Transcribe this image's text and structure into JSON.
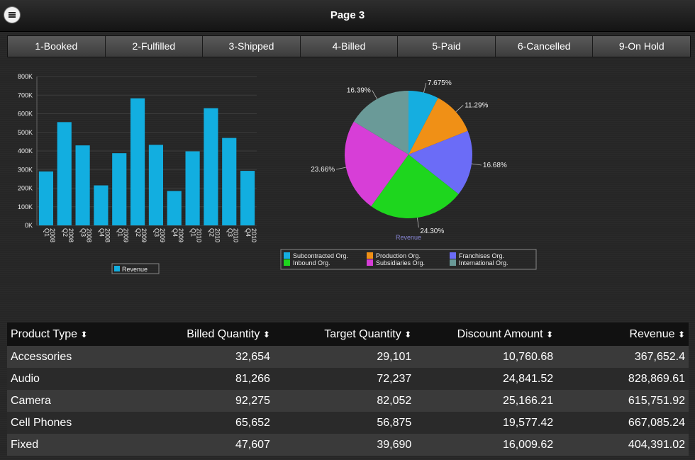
{
  "header": {
    "title": "Page 3",
    "menu_icon": "hamburger-menu-icon"
  },
  "tabs": [
    "1-Booked",
    "2-Fulfilled",
    "3-Shipped",
    "4-Billed",
    "5-Paid",
    "6-Cancelled",
    "9-On Hold"
  ],
  "colors": {
    "bar": "#12aee0"
  },
  "chart_data": [
    {
      "type": "bar",
      "categories": [
        "Q1 2008",
        "Q2 2008",
        "Q3 2008",
        "Q4 2008",
        "Q1 2009",
        "Q2 2009",
        "Q3 2009",
        "Q4 2009",
        "Q1 2010",
        "Q2 2010",
        "Q3 2010",
        "Q4 2010"
      ],
      "category_lines": [
        [
          "Q1",
          "2008"
        ],
        [
          "Q2",
          "2008"
        ],
        [
          "Q3",
          "2008"
        ],
        [
          "Q4",
          "2008"
        ],
        [
          "Q1",
          "2009"
        ],
        [
          "Q2",
          "2009"
        ],
        [
          "Q3",
          "2009"
        ],
        [
          "Q4",
          "2009"
        ],
        [
          "Q1",
          "2010"
        ],
        [
          "Q2",
          "2010"
        ],
        [
          "Q3",
          "2010"
        ],
        [
          "Q4",
          "2010"
        ]
      ],
      "series": [
        {
          "name": "Revenue",
          "values": [
            290000,
            555000,
            430000,
            215000,
            388000,
            683000,
            433000,
            185000,
            398000,
            630000,
            470000,
            293000
          ]
        }
      ],
      "ylim": [
        0,
        800000
      ],
      "yticks": [
        "0K",
        "100K",
        "200K",
        "300K",
        "400K",
        "500K",
        "600K",
        "700K",
        "800K"
      ],
      "legend": "bottom",
      "grid": true
    },
    {
      "type": "pie",
      "subtitle": "Revenue",
      "slices": [
        {
          "label": "Subcontracted Org.",
          "value": 7.675,
          "text": "7.675%",
          "color": "#15aee0"
        },
        {
          "label": "Production Org.",
          "value": 11.29,
          "text": "11.29%",
          "color": "#f09016"
        },
        {
          "label": "Franchises Org.",
          "value": 16.68,
          "text": "16.68%",
          "color": "#6b6cf7"
        },
        {
          "label": "Inbound Org.",
          "value": 24.3,
          "text": "24.30%",
          "color": "#1ed61e"
        },
        {
          "label": "Subsidiaries Org.",
          "value": 23.66,
          "text": "23.66%",
          "color": "#d73ed7"
        },
        {
          "label": "International Org.",
          "value": 16.39,
          "text": "16.39%",
          "color": "#6a9a98"
        }
      ],
      "legend_order": [
        "Subcontracted Org.",
        "Production Org.",
        "Franchises Org.",
        "Inbound Org.",
        "Subsidiaries Org.",
        "International Org."
      ],
      "legend": "bottom"
    }
  ],
  "table": {
    "columns": [
      "Product Type",
      "Billed Quantity",
      "Target Quantity",
      "Discount Amount",
      "Revenue"
    ],
    "sort_icon": "sort-arrows-icon",
    "rows": [
      [
        "Accessories",
        "32,654",
        "29,101",
        "10,760.68",
        "367,652.4"
      ],
      [
        "Audio",
        "81,266",
        "72,237",
        "24,841.52",
        "828,869.61"
      ],
      [
        "Camera",
        "92,275",
        "82,052",
        "25,166.21",
        "615,751.92"
      ],
      [
        "Cell Phones",
        "65,652",
        "56,875",
        "19,577.42",
        "667,085.24"
      ],
      [
        "Fixed",
        "47,607",
        "39,690",
        "16,009.62",
        "404,391.02"
      ]
    ]
  }
}
